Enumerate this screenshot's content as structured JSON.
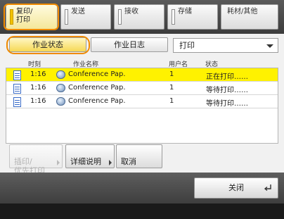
{
  "tabs": [
    {
      "label": "复印/\n打印",
      "active": true
    },
    {
      "label": "发送",
      "active": false
    },
    {
      "label": "接收",
      "active": false
    },
    {
      "label": "存储",
      "active": false
    },
    {
      "label": "耗材/其他",
      "active": false
    }
  ],
  "subtabs": {
    "job_status": "作业状态",
    "job_log": "作业日志"
  },
  "filter_select": {
    "value": "打印"
  },
  "table": {
    "headers": {
      "time": "时刻",
      "job_name": "作业名称",
      "user": "用户名",
      "status": "状态"
    },
    "rows": [
      {
        "time": "1:16",
        "job_name": "Conference Pap.",
        "user": "1",
        "status": "正在打印……",
        "selected": true
      },
      {
        "time": "1:16",
        "job_name": "Conference Pap.",
        "user": "1",
        "status": "等待打印……",
        "selected": false
      },
      {
        "time": "1:16",
        "job_name": "Conference Pap.",
        "user": "1",
        "status": "等待打印……",
        "selected": false
      }
    ]
  },
  "buttons": {
    "priority_print": "插印/\n优先打印",
    "details": "详细说明",
    "cancel": "取消"
  },
  "bottom": {
    "close": "关闭"
  },
  "colors": {
    "highlight": "#f08a00",
    "selected_row": "#fff200",
    "active_tab": "#f4e79a"
  }
}
